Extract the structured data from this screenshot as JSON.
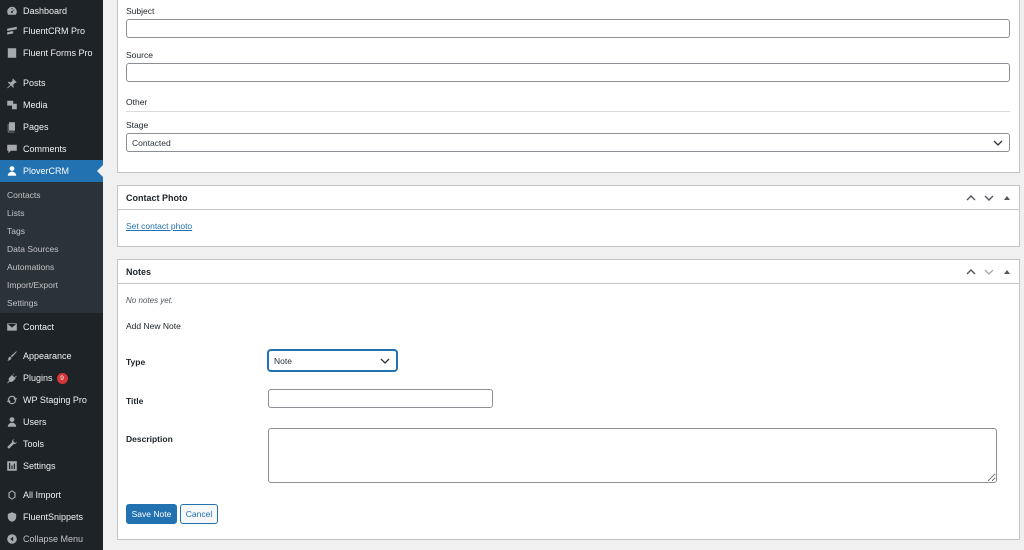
{
  "sidebar": {
    "items": [
      {
        "label": "Dashboard",
        "icon": "dashboard-icon"
      },
      {
        "label": "FluentCRM Pro",
        "icon": "fluentcrm-icon"
      },
      {
        "label": "Fluent Forms Pro",
        "icon": "fluent-forms-icon"
      },
      {
        "label": "Posts",
        "icon": "pin-icon"
      },
      {
        "label": "Media",
        "icon": "media-icon"
      },
      {
        "label": "Pages",
        "icon": "pages-icon"
      },
      {
        "label": "Comments",
        "icon": "comment-icon"
      },
      {
        "label": "PloverCRM",
        "icon": "person-icon"
      },
      {
        "label": "Contact",
        "icon": "envelope-icon"
      },
      {
        "label": "Appearance",
        "icon": "brush-icon"
      },
      {
        "label": "Plugins",
        "icon": "plug-icon",
        "badge": "9"
      },
      {
        "label": "WP Staging Pro",
        "icon": "refresh-icon"
      },
      {
        "label": "Users",
        "icon": "users-icon"
      },
      {
        "label": "Tools",
        "icon": "wrench-icon"
      },
      {
        "label": "Settings",
        "icon": "sliders-icon"
      },
      {
        "label": "All Import",
        "icon": "import-icon"
      },
      {
        "label": "FluentSnippets",
        "icon": "shield-icon"
      },
      {
        "label": "Collapse Menu",
        "icon": "collapse-icon"
      }
    ],
    "submenu": [
      "Contacts",
      "Lists",
      "Tags",
      "Data Sources",
      "Automations",
      "Import/Export",
      "Settings"
    ]
  },
  "details": {
    "subject_label": "Subject",
    "subject_value": "",
    "source_label": "Source",
    "source_value": "",
    "other_heading": "Other",
    "stage_label": "Stage",
    "stage_value": "Contacted"
  },
  "photo_panel": {
    "title": "Contact Photo",
    "set_link": "Set contact photo"
  },
  "notes_panel": {
    "title": "Notes",
    "empty": "No notes yet.",
    "add_heading": "Add New Note",
    "type_label": "Type",
    "type_value": "Note",
    "title_label": "Title",
    "title_value": "",
    "desc_label": "Description",
    "desc_value": "",
    "save_label": "Save Note",
    "cancel_label": "Cancel"
  },
  "colors": {
    "sidebar_bg": "#1d2327",
    "accent": "#2271b1",
    "badge": "#d63638"
  }
}
